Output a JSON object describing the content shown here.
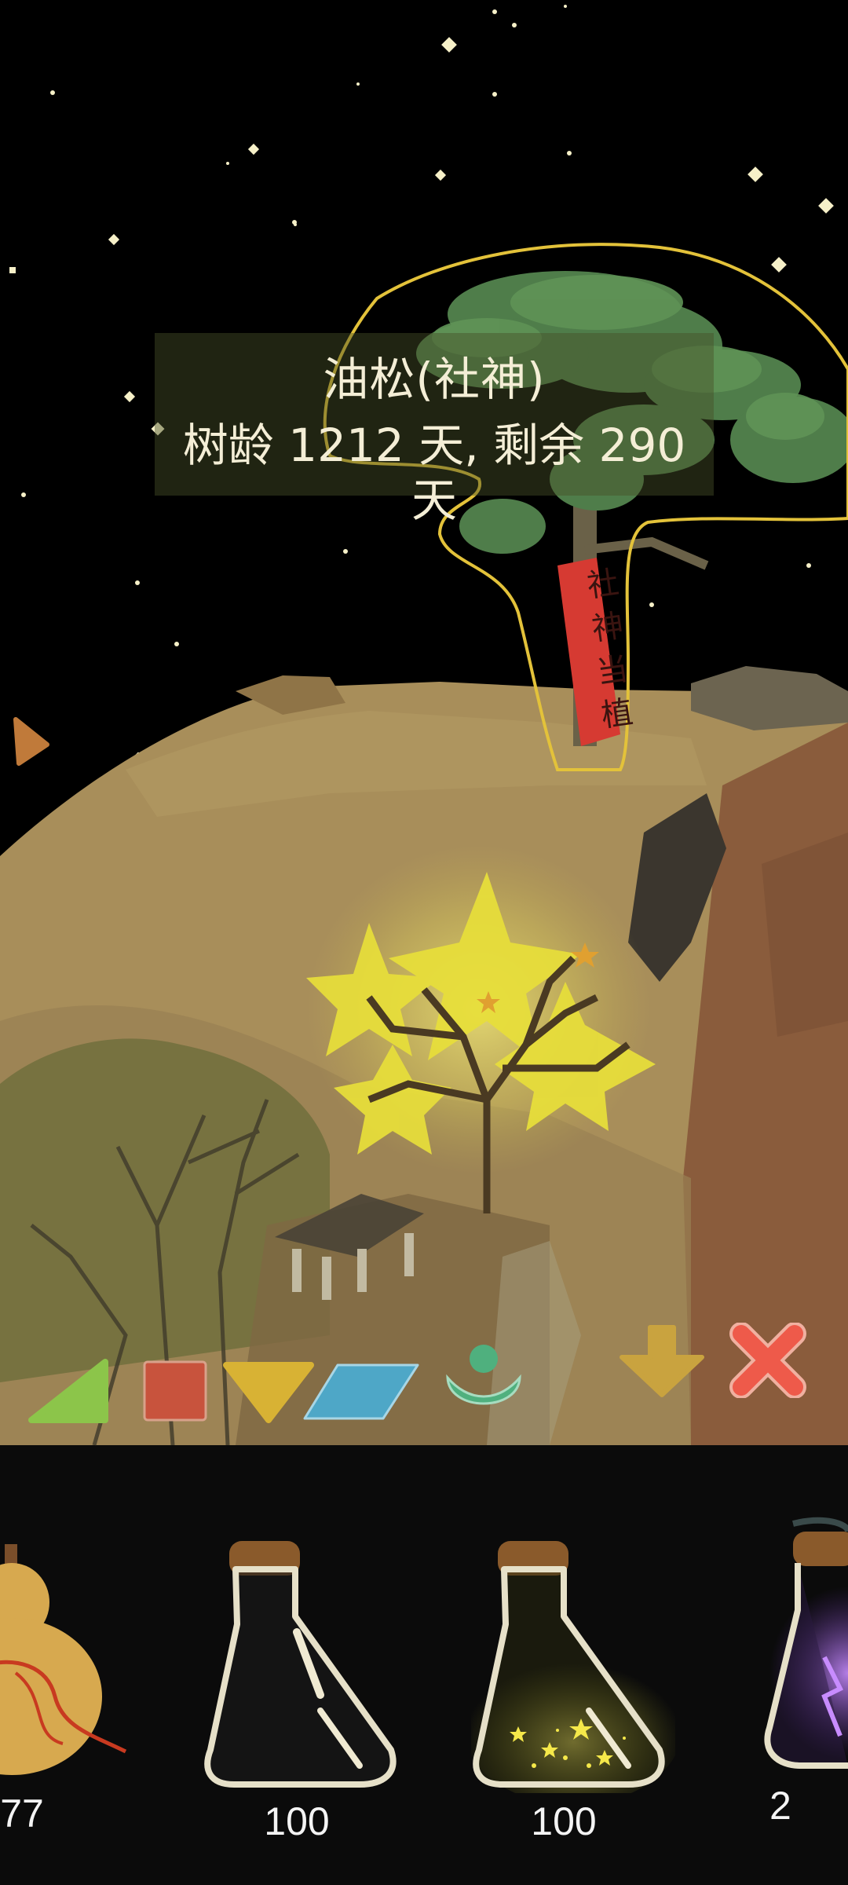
{
  "tree_info": {
    "title": "油松(社神)",
    "age_text": "树龄 1212 天, 剩余 290 天"
  },
  "sign_text": "社神当植",
  "toolbar": {
    "icons": [
      "green-triangle-icon",
      "red-square-icon",
      "yellow-down-triangle-icon",
      "blue-parallelogram-icon",
      "green-person-icon",
      "download-arrow-icon",
      "close-x-icon"
    ],
    "colors": {
      "green": "#8cc54a",
      "red": "#c8533d",
      "yellow": "#d8b234",
      "blue": "#4ea7c7",
      "teal": "#4fb07e",
      "gold": "#c9a33f",
      "coral": "#ee5a4a"
    }
  },
  "inventory": {
    "items": [
      {
        "name": "gourd",
        "count": "77"
      },
      {
        "name": "empty-flask",
        "count": "100"
      },
      {
        "name": "star-flask",
        "count": "100"
      },
      {
        "name": "purple-flask",
        "count": "2"
      }
    ]
  }
}
